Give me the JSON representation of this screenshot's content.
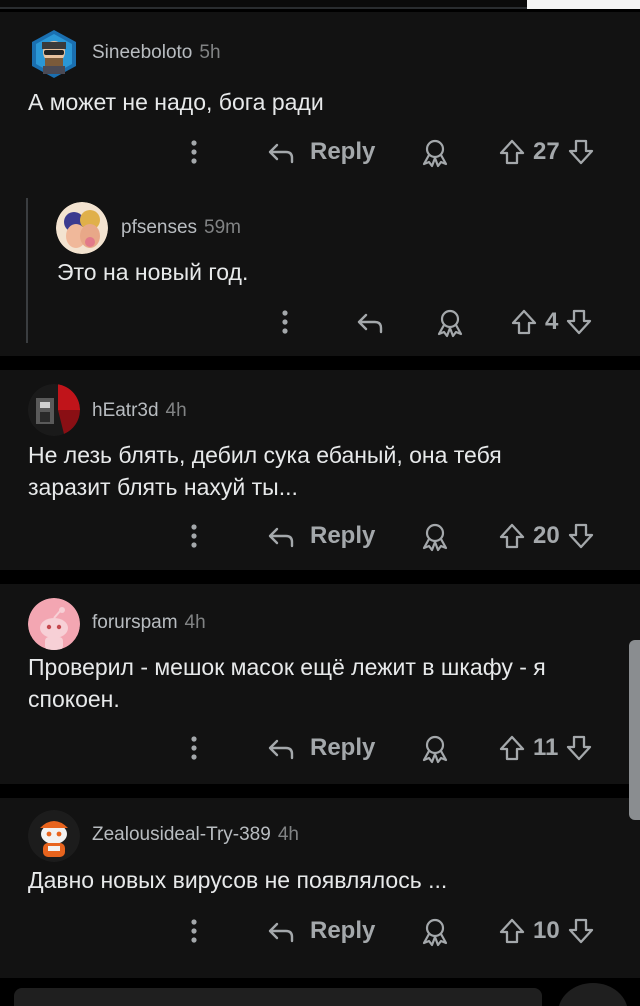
{
  "colors": {
    "background": "#000000",
    "card": "#121212",
    "text": "#e7e9ea",
    "muted": "#818384"
  },
  "comments": [
    {
      "author": "Sineeboloto",
      "time": "5h",
      "text": "А может не надо, бога ради",
      "reply_label": "Reply",
      "score": "27",
      "avatar": "cyborg-avatar"
    },
    {
      "author": "pfsenses",
      "time": "59m",
      "text": "Это на новый год.",
      "reply_label": "",
      "score": "4",
      "avatar": "couple-avatar"
    },
    {
      "author": "hEatr3d",
      "time": "4h",
      "text_lines": [
        "Не лезь блять, дебил сука ебаный, она тебя",
        "заразит блять нахуй ты..."
      ],
      "reply_label": "Reply",
      "score": "20",
      "avatar": "red-black-avatar"
    },
    {
      "author": "forurspam",
      "time": "4h",
      "text_lines": [
        "Проверил - мешок масок ещё лежит в шкафу - я",
        "спокоен."
      ],
      "reply_label": "Reply",
      "score": "11",
      "avatar": "snoo-pink-avatar"
    },
    {
      "author": "Zealousideal-Try-389",
      "time": "4h",
      "text": "Давно новых вирусов не появлялось ...",
      "reply_label": "Reply",
      "score": "10",
      "avatar": "snoo-orange-avatar"
    }
  ],
  "icons": {
    "more": "more-vertical-icon",
    "reply": "reply-arrow-icon",
    "award": "award-icon",
    "upvote": "upvote-arrow-icon",
    "downvote": "downvote-arrow-icon"
  }
}
